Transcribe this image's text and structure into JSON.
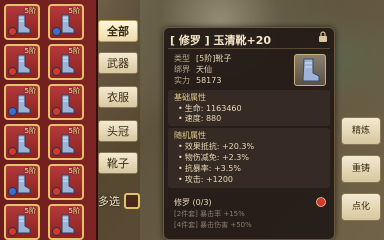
{
  "inventory": {
    "slots": [
      {
        "level": "5阶",
        "badge": "red"
      },
      {
        "level": "5阶",
        "badge": "blue"
      },
      {
        "level": "5阶",
        "badge": "red"
      },
      {
        "level": "5阶",
        "badge": "red"
      },
      {
        "level": "5阶",
        "badge": "blue"
      },
      {
        "level": "5阶",
        "badge": "red"
      },
      {
        "level": "5阶",
        "badge": "red"
      },
      {
        "level": "5阶",
        "badge": "red"
      },
      {
        "level": "5阶",
        "badge": "blue"
      },
      {
        "level": "5阶",
        "badge": "red"
      },
      {
        "level": "5阶",
        "badge": "red"
      },
      {
        "level": "5阶",
        "badge": "red"
      }
    ]
  },
  "tabs": [
    {
      "label": "全部",
      "active": true
    },
    {
      "label": "武器",
      "active": false
    },
    {
      "label": "衣服",
      "active": false
    },
    {
      "label": "头冠",
      "active": false
    },
    {
      "label": "靴子",
      "active": false
    }
  ],
  "multi_select": {
    "label": "多选"
  },
  "item": {
    "title": "[ 修罗 ] 玉清靴+20",
    "info": [
      {
        "key": "类型",
        "value": "[5阶]靴子"
      },
      {
        "key": "绑界",
        "value": "天仙"
      },
      {
        "key": "实力",
        "value": "58173"
      }
    ],
    "base": {
      "title": "基础属性",
      "stats": [
        "生命: 1163460",
        "速度: 880"
      ]
    },
    "random": {
      "title": "随机属性",
      "stats": [
        "效果抵抗: +20.3%",
        "物伤减免: +2.3%",
        "抗暴率: +3.5%",
        "攻击: +1200"
      ]
    },
    "set": {
      "title": "修罗 (0/3)",
      "lines": [
        "[2件套] 暴击率 +15%",
        "[4件套] 暴击伤害 +50%"
      ]
    }
  },
  "actions": [
    {
      "label": "精炼"
    },
    {
      "label": "重铸"
    },
    {
      "label": "点化"
    }
  ],
  "colors": {
    "panel_red": "#7e2424",
    "gold_border": "#e7c06a",
    "card_bg": "#241c18"
  }
}
